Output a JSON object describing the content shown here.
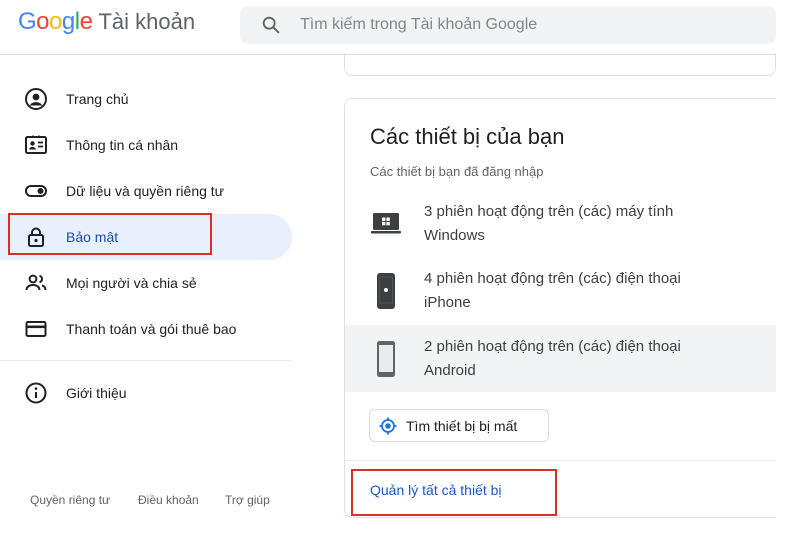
{
  "header": {
    "logo_letters": [
      {
        "char": "G",
        "color": "#4285F4"
      },
      {
        "char": "o",
        "color": "#EA4335"
      },
      {
        "char": "o",
        "color": "#FBBC05"
      },
      {
        "char": "g",
        "color": "#4285F4"
      },
      {
        "char": "l",
        "color": "#34A853"
      },
      {
        "char": "e",
        "color": "#EA4335"
      }
    ],
    "product_name": "Tài khoản",
    "search_placeholder": "Tìm kiếm trong Tài khoản Google"
  },
  "sidebar": {
    "items": [
      {
        "label": "Trang chủ",
        "icon": "account-circle-icon",
        "active": false
      },
      {
        "label": "Thông tin cá nhân",
        "icon": "id-card-icon",
        "active": false
      },
      {
        "label": "Dữ liệu và quyền riêng tư",
        "icon": "toggle-icon",
        "active": false
      },
      {
        "label": "Bảo mật",
        "icon": "lock-icon",
        "active": true
      },
      {
        "label": "Mọi người và chia sẻ",
        "icon": "people-icon",
        "active": false
      },
      {
        "label": "Thanh toán và gói thuê bao",
        "icon": "credit-card-icon",
        "active": false
      },
      {
        "label": "Giới thiệu",
        "icon": "info-icon",
        "active": false
      }
    ],
    "footer_links": [
      "Quyền riêng tư",
      "Điều khoản",
      "Trợ giúp"
    ]
  },
  "devices_card": {
    "title": "Các thiết bị của bạn",
    "subtitle": "Các thiết bị bạn đã đăng nhập",
    "devices": [
      {
        "line1": "3 phiên hoạt động trên (các) máy tính",
        "line2": "Windows",
        "icon": "windows-laptop-icon"
      },
      {
        "line1": "4 phiên hoạt động trên (các) điện thoại",
        "line2": "iPhone",
        "icon": "iphone-icon"
      },
      {
        "line1": "2 phiên hoạt động trên (các) điện thoại",
        "line2": "Android",
        "icon": "android-phone-icon"
      }
    ],
    "find_device_button": "Tìm thiết bị bị mất",
    "manage_link": "Quản lý tất cả thiết bị"
  },
  "colors": {
    "accent_blue": "#1a73e8",
    "active_nav_bg": "#e8f0fe",
    "highlight_red": "#d93025"
  }
}
